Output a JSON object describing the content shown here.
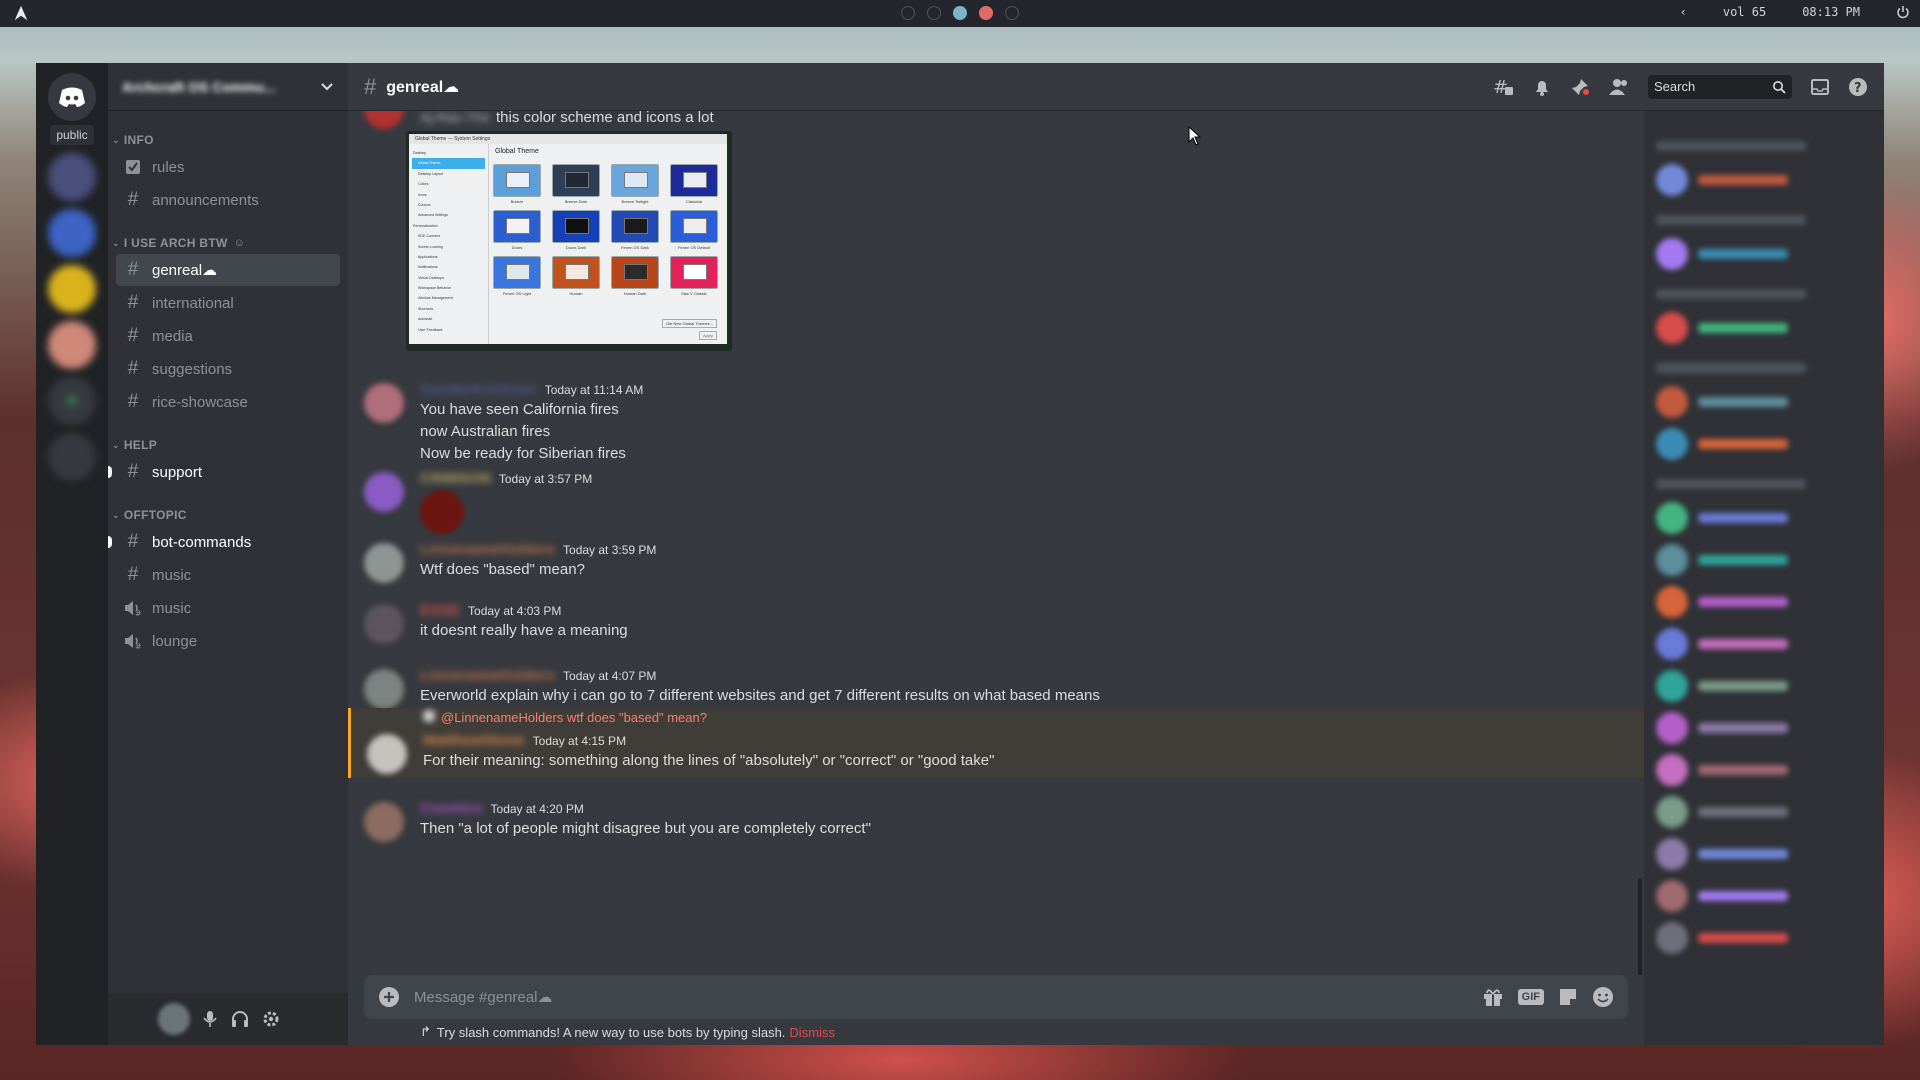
{
  "topbar": {
    "workspaces": 5,
    "active_workspace": 3,
    "volume": "vol 65",
    "clock": "08:13 PM"
  },
  "guilds": {
    "public_label": "public"
  },
  "server": {
    "name": "Archcraft OS Commu..."
  },
  "categories": [
    {
      "label": "INFO",
      "channels": [
        {
          "name": "rules",
          "icon": "rules-icon"
        },
        {
          "name": "announcements",
          "icon": "hash-icon"
        }
      ]
    },
    {
      "label": "I USE ARCH BTW",
      "channels": [
        {
          "name": "genreal☁",
          "icon": "hash-icon",
          "active": true
        },
        {
          "name": "international",
          "icon": "hash-icon"
        },
        {
          "name": "media",
          "icon": "hash-icon"
        },
        {
          "name": "suggestions",
          "icon": "hash-icon"
        },
        {
          "name": "rice-showcase",
          "icon": "hash-icon"
        }
      ]
    },
    {
      "label": "HELP",
      "channels": [
        {
          "name": "support",
          "icon": "hash-icon",
          "unread": true
        }
      ]
    },
    {
      "label": "OFFTOPIC",
      "channels": [
        {
          "name": "bot-commands",
          "icon": "hash-icon",
          "unread": true
        },
        {
          "name": "music",
          "icon": "hash-icon"
        },
        {
          "name": "music",
          "icon": "voice-icon"
        },
        {
          "name": "lounge",
          "icon": "voice-icon"
        }
      ]
    }
  ],
  "header": {
    "channel_name": "genreal☁",
    "search_placeholder": "Search"
  },
  "theme_screenshot": {
    "window_title": "Global Theme — System Settings",
    "heading": "Global Theme",
    "button": "Get New Global Themes...",
    "apply": "Apply",
    "sidebar": [
      "Desktop",
      "Global Theme",
      "Desktop Layout",
      "Colors",
      "Icons",
      "Cursors",
      "Advanced Settings",
      "Personalization",
      "KDE Connect",
      "Screen Locking",
      "Applications",
      "Notifications",
      "Virtual Desktops",
      "Workspace Behavior",
      "Window Management",
      "Shortcuts",
      "Autostart",
      "User Feedback"
    ],
    "themes": [
      "Breeze",
      "Breeze Dark",
      "Breeze Twilight",
      "Classical",
      "Doors",
      "Doors Dark",
      "Fenen OS Dark",
      "Fenen OS Default",
      "Fenen OS Light",
      "Human",
      "Human Dark",
      "Mac V Classic"
    ]
  },
  "messages": [
    {
      "author": "Aj-Rac-Thx",
      "time": "",
      "lines": [
        "this color scheme and icons a lot"
      ]
    },
    {
      "author": "SundarKrishnan",
      "time": "Today at 11:14 AM",
      "lines": [
        "You have seen California fires",
        "now Australian fires",
        "Now be ready for Siberian fires"
      ]
    },
    {
      "author": "CRIMSON",
      "time": "Today at 3:57 PM",
      "lines": []
    },
    {
      "author": "LinnenameHolders",
      "time": "Today at 3:59 PM",
      "lines": [
        "Wtf does \"based\" mean?"
      ]
    },
    {
      "author": "ESSE",
      "time": "Today at 4:03 PM",
      "lines": [
        "it doesnt really have a meaning"
      ]
    },
    {
      "author": "LinnenameHolders",
      "time": "Today at 4:07 PM",
      "lines": [
        "Everworld explain why i can go to 7 different websites and get 7 different results on what based means"
      ]
    },
    {
      "author": "MatthewStone",
      "time": "Today at 4:15 PM",
      "reply": "@LinnenameHolders wtf does \"based\" mean?",
      "lines": [
        "For their meaning: something along the lines of \"absolutely\" or \"correct\" or \"good take\""
      ]
    },
    {
      "author": "Cosmics",
      "time": "Today at 4:20 PM",
      "lines": [
        "Then \"a lot of people might disagree but you are completely correct\""
      ]
    }
  ],
  "composer": {
    "placeholder": "Message #genreal☁",
    "gif": "GIF"
  },
  "tip": {
    "text": "Try slash commands! A new way to use bots by typing slash.",
    "dismiss": "Dismiss"
  },
  "members": {
    "categories": [
      "BOOSTAPP BOOSTERS — 1",
      "MODERATORS — 1",
      "BOOSTAPP CORONERS — 1",
      "CODING ARCH BOX — 3",
      "ONLINE — 15"
    ]
  },
  "colors": {
    "accent": "#7289da",
    "bg": "#36393f",
    "sidebar": "#2f3136",
    "guildbar": "#202225",
    "dismiss": "#f04747"
  }
}
